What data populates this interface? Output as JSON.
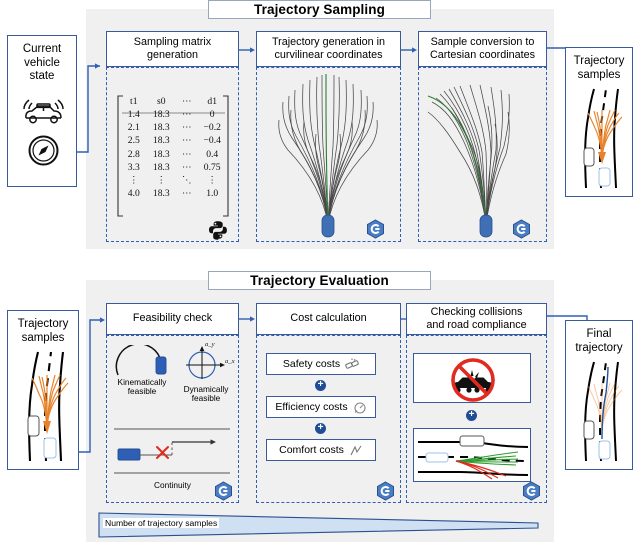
{
  "sections": [
    {
      "id": "sampling",
      "title": "Trajectory Sampling"
    },
    {
      "id": "evaluation",
      "title": "Trajectory Evaluation"
    }
  ],
  "colors": {
    "border_blue": "#3b5a9a",
    "dashed_blue": "#2f5fb5",
    "panel_grey": "#f0f0f0",
    "orange": "#e8832a",
    "green": "#2e7d32",
    "red": "#e02b20",
    "blue_accent": "#1f4e96"
  },
  "top_row": {
    "input_box": {
      "title_lines": [
        "Current",
        "vehicle",
        "state"
      ],
      "icons": [
        "sensor-vehicle-icon",
        "compass-icon"
      ]
    },
    "stages": [
      {
        "id": "sampling-matrix",
        "title_lines": [
          "Sampling matrix",
          "generation"
        ],
        "badge": "python-logo-icon",
        "matrix": {
          "headers": [
            "t1",
            "s0",
            "⋯",
            "d1"
          ],
          "rows": [
            [
              "1.4",
              "18.3",
              "⋯",
              "0"
            ],
            [
              "2.1",
              "18.3",
              "⋯",
              "−0.2"
            ],
            [
              "2.5",
              "18.3",
              "⋯",
              "−0.4"
            ],
            [
              "2.8",
              "18.3",
              "⋯",
              "0.4"
            ],
            [
              "3.3",
              "18.3",
              "⋯",
              "0.75"
            ],
            [
              "⋮",
              "⋮",
              "⋱",
              "⋮"
            ],
            [
              "4.0",
              "18.3",
              "⋯",
              "1.0"
            ]
          ]
        }
      },
      {
        "id": "curvilinear-generation",
        "title_lines": [
          "Trajectory generation in",
          "curvilinear coordinates"
        ],
        "badge": "cpp-logo-icon",
        "figure": "straight-trajectory-fan"
      },
      {
        "id": "cartesian-conversion",
        "title_lines": [
          "Sample conversion to",
          "Cartesian coordinates"
        ],
        "badge": "cpp-logo-icon",
        "figure": "curved-trajectory-fan"
      }
    ],
    "output_box": {
      "title_lines": [
        "Trajectory",
        "samples"
      ],
      "figure": "road-with-orange-trajectories"
    }
  },
  "bottom_row": {
    "input_box": {
      "title_lines": [
        "Trajectory",
        "samples"
      ],
      "figure": "road-with-orange-trajectories"
    },
    "stages": [
      {
        "id": "feasibility-check",
        "title_lines": [
          "Feasibility check"
        ],
        "badge": "cpp-logo-icon",
        "items": [
          {
            "label_lines": [
              "Kinematically",
              "feasible"
            ],
            "icon": "curvature-arc-vehicle-icon"
          },
          {
            "label_lines": [
              "Dynamically",
              "feasible"
            ],
            "icon": "friction-circle-icon",
            "axis_labels": [
              "a_y",
              "a_x"
            ]
          },
          {
            "label_lines": [
              "Continuity"
            ],
            "icon": "continuity-discontinuity-icon"
          }
        ]
      },
      {
        "id": "cost-calculation",
        "title_lines": [
          "Cost calculation"
        ],
        "badge": "cpp-logo-icon",
        "costs": [
          {
            "label": "Safety costs",
            "icon": "crash-safety-icon"
          },
          {
            "label": "Efficiency costs",
            "icon": "speed-gauge-icon"
          },
          {
            "label": "Comfort costs",
            "icon": "jerk-comfort-icon"
          }
        ],
        "operators": [
          "+",
          "+"
        ]
      },
      {
        "id": "collision-road-check",
        "title_lines": [
          "Checking collisions",
          "and road compliance"
        ],
        "badge": "cpp-logo-icon",
        "panels": [
          {
            "icon": "no-collision-sign-icon"
          },
          {
            "icon": "road-compliance-trajectories-icon"
          }
        ],
        "operators": [
          "+"
        ]
      }
    ],
    "output_box": {
      "title_lines": [
        "Final",
        "trajectory"
      ],
      "figure": "road-with-final-blue-trajectory"
    }
  },
  "wedge": {
    "label": "Number of trajectory samples"
  }
}
